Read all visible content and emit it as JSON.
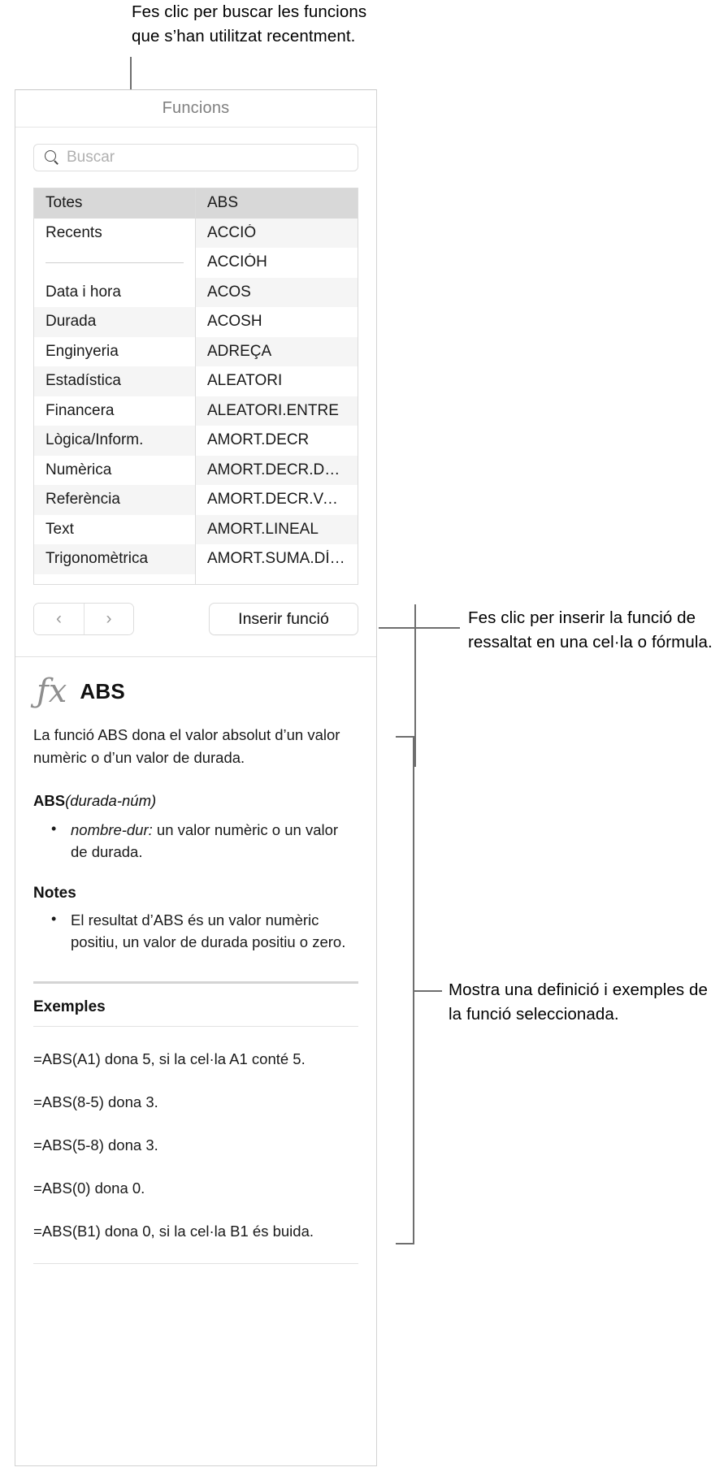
{
  "callouts": {
    "search_hint": "Fes clic per buscar les funcions que s’han utilitzat recentment.",
    "insert_hint": "Fes clic per inserir la funció de ressaltat en una cel·la o fórmula.",
    "detail_hint": "Mostra una definició i exemples de la funció seleccionada."
  },
  "panel": {
    "title": "Funcions"
  },
  "search": {
    "placeholder": "Buscar",
    "value": "",
    "icon": "search-icon"
  },
  "categories": [
    {
      "label": "Totes",
      "selected": true
    },
    {
      "label": "Recents",
      "selected": false
    },
    {
      "label": "",
      "separator": true
    },
    {
      "label": "Data i hora",
      "selected": false
    },
    {
      "label": "Durada",
      "selected": false
    },
    {
      "label": "Enginyeria",
      "selected": false
    },
    {
      "label": "Estadística",
      "selected": false
    },
    {
      "label": "Financera",
      "selected": false
    },
    {
      "label": "Lògica/Inform.",
      "selected": false
    },
    {
      "label": "Numèrica",
      "selected": false
    },
    {
      "label": "Referència",
      "selected": false
    },
    {
      "label": "Text",
      "selected": false
    },
    {
      "label": "Trigonomètrica",
      "selected": false
    }
  ],
  "functions": [
    {
      "label": "ABS",
      "selected": true
    },
    {
      "label": "ACCIÓ",
      "selected": false
    },
    {
      "label": "ACCIÓH",
      "selected": false
    },
    {
      "label": "ACOS",
      "selected": false
    },
    {
      "label": "ACOSH",
      "selected": false
    },
    {
      "label": "ADREÇA",
      "selected": false
    },
    {
      "label": "ALEATORI",
      "selected": false
    },
    {
      "label": "ALEATORI.ENTRE",
      "selected": false
    },
    {
      "label": "AMORT.DECR",
      "selected": false
    },
    {
      "label": "AMORT.DECR.DO…",
      "selected": false
    },
    {
      "label": "AMORT.DECR.VA…",
      "selected": false
    },
    {
      "label": "AMORT.LINEAL",
      "selected": false
    },
    {
      "label": "AMORT.SUMA.DÍ…",
      "selected": false
    }
  ],
  "buttons": {
    "prev": "‹",
    "next": "›",
    "insert_function": "Inserir funció"
  },
  "detail": {
    "fx_glyph": "ƒx",
    "function_name": "ABS",
    "description": "La funció ABS dona el valor absolut d’un valor numèric o d’un valor de durada.",
    "syntax_name": "ABS",
    "syntax_args": "(durada-núm)",
    "parameters": [
      {
        "name": "nombre-dur:",
        "text": " un valor numèric o un valor de durada."
      }
    ],
    "notes_heading": "Notes",
    "notes": [
      "El resultat d’ABS és un valor numèric positiu, un valor de durada positiu o zero."
    ],
    "examples_heading": "Exemples",
    "examples": [
      "=ABS(A1) dona 5, si la cel·la A1 conté 5.",
      "=ABS(8-5) dona 3.",
      "=ABS(5-8) dona 3.",
      "=ABS(0) dona 0.",
      "=ABS(B1) dona 0, si la cel·la B1 és buida."
    ]
  }
}
